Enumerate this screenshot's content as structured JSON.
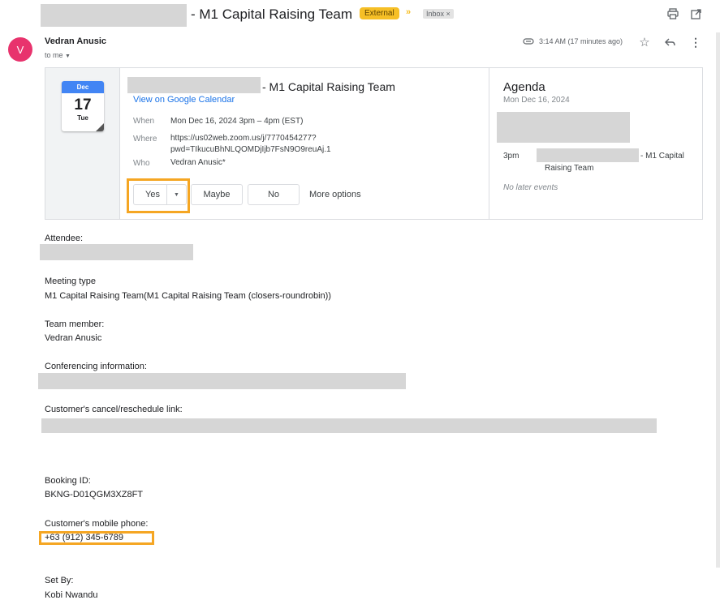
{
  "header": {
    "subject_suffix": "- M1 Capital Raising Team",
    "badge_external": "External",
    "badge_inbox": "Inbox",
    "badge_inbox_close": "×"
  },
  "message": {
    "avatar_letter": "V",
    "sender": "Vedran Anusic",
    "to": "to me",
    "time": "3:14 AM (17 minutes ago)"
  },
  "event": {
    "month": "Dec",
    "day": "17",
    "dow": "Tue",
    "title_suffix": "- M1 Capital Raising Team",
    "gcal_link": "View on Google Calendar",
    "when_label": "When",
    "when_value": "Mon Dec 16, 2024 3pm – 4pm (EST)",
    "where_label": "Where",
    "where_line1": "https://us02web.zoom.us/j/7770454277?",
    "where_line2": "pwd=TIkucuBhNLQOMDjIjb7FsN9O9reuAj.1",
    "who_label": "Who",
    "who_value": "Vedran Anusic*",
    "rsvp": {
      "yes": "Yes",
      "maybe": "Maybe",
      "no": "No",
      "more": "More options"
    }
  },
  "agenda": {
    "title": "Agenda",
    "date": "Mon Dec 16, 2024",
    "time": "3pm",
    "event_suffix": "- M1 Capital",
    "event_line2": "Raising Team",
    "empty": "No later events"
  },
  "body": {
    "attendee_label": "Attendee:",
    "meeting_type_label": "Meeting type",
    "meeting_type_value": "M1 Capital Raising Team(M1 Capital Raising Team (closers-roundrobin))",
    "team_member_label": "Team member:",
    "team_member_value": "Vedran Anusic",
    "conferencing_label": "Conferencing information:",
    "cancel_label": "Customer's cancel/reschedule link:",
    "booking_label": "Booking ID:",
    "booking_value": "BKNG-D01QGM3XZ8FT",
    "phone_label": "Customer's mobile phone:",
    "phone_value": "+63 (912) 345-6789",
    "set_by_label": "Set By:",
    "set_by_value": "Kobi Nwandu"
  },
  "colors": {
    "accent_link": "#1a73e8",
    "highlight": "#f5a623",
    "avatar": "#e8336d",
    "calendar_blue": "#4285f4",
    "external_badge": "#f6bf26"
  }
}
